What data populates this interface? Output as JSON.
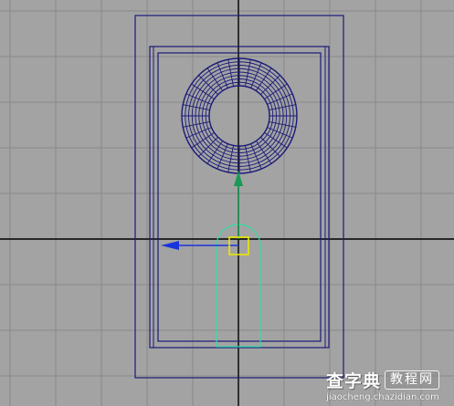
{
  "viewport": {
    "view": "front orthographic",
    "background_color": "#a3a3a3",
    "grid_color": "#8a8a8a",
    "axis_color": "#000000",
    "wireframe_color": "#1a1a7a",
    "selection_color": "#33ddaa",
    "manipulator": {
      "x_axis_color": "#1a33dd",
      "y_axis_color": "#1a9955",
      "center_handle_color": "#e8e800"
    }
  },
  "objects": [
    {
      "name": "outer-frame",
      "shape": "rectangle",
      "selected": false
    },
    {
      "name": "inner-frame",
      "shape": "rectangle",
      "selected": false
    },
    {
      "name": "torus-mesh",
      "shape": "torus",
      "rings": 8,
      "segments": 32,
      "selected": false
    },
    {
      "name": "capsule-object",
      "shape": "capsule",
      "selected": true
    }
  ],
  "icons": {
    "move_x": "arrow-left-icon",
    "move_y": "arrow-up-icon",
    "move_center": "square-handle-icon"
  },
  "watermark": {
    "brand": "查字典",
    "badge": "教程网",
    "url": "jiaocheng.chazidian.com"
  }
}
